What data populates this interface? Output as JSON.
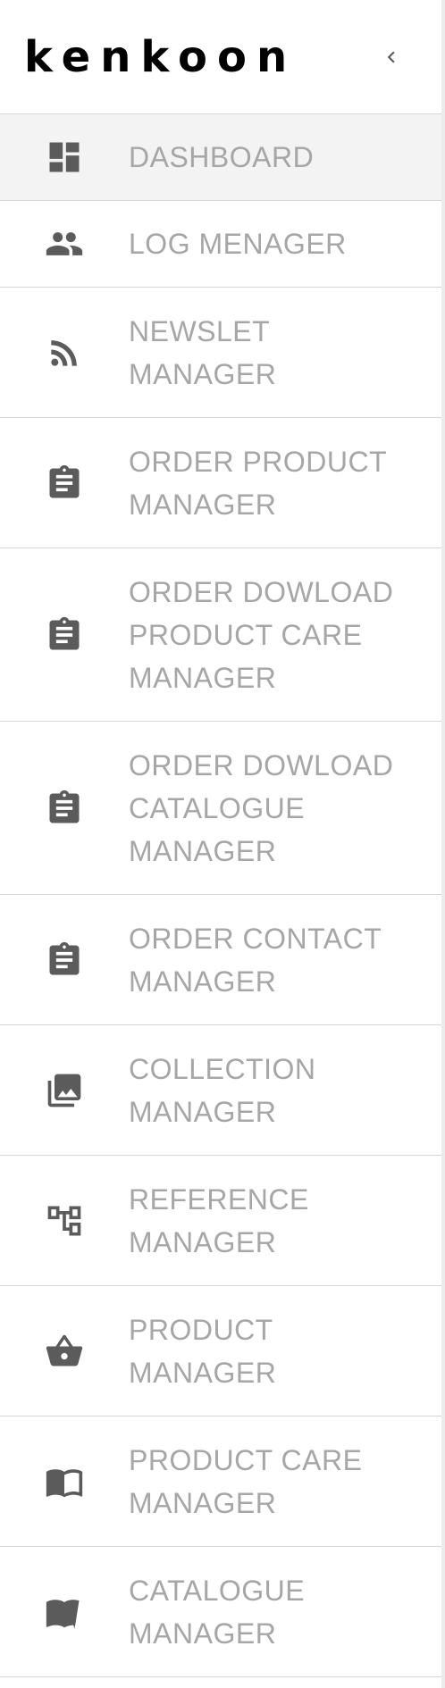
{
  "brand": {
    "logo_text": "kenkoon"
  },
  "header": {
    "collapse_icon": "chevron-left-icon"
  },
  "menu": {
    "items": [
      {
        "line1": "DASHBOARD",
        "line2": "",
        "line3": "",
        "icon": "dashboard-icon",
        "active": true
      },
      {
        "line1": "LOG MENAGER",
        "line2": "",
        "line3": "",
        "icon": "people-icon",
        "active": false
      },
      {
        "line1": "NEWSLET",
        "line2": "MANAGER",
        "line3": "",
        "icon": "rss-feed-icon",
        "active": false
      },
      {
        "line1": "ORDER PRODUCT",
        "line2": "MANAGER",
        "line3": "",
        "icon": "clipboard-icon",
        "active": false
      },
      {
        "line1": "ORDER DOWLOAD",
        "line2": "PRODUCT CARE",
        "line3": "MANAGER",
        "icon": "clipboard-icon",
        "active": false
      },
      {
        "line1": "ORDER DOWLOAD",
        "line2": "CATALOGUE",
        "line3": "MANAGER",
        "icon": "clipboard-icon",
        "active": false
      },
      {
        "line1": "ORDER CONTACT",
        "line2": "MANAGER",
        "line3": "",
        "icon": "clipboard-icon",
        "active": false
      },
      {
        "line1": "COLLECTION",
        "line2": "MANAGER",
        "line3": "",
        "icon": "photo-library-icon",
        "active": false
      },
      {
        "line1": "REFERENCE",
        "line2": "MANAGER",
        "line3": "",
        "icon": "account-tree-icon",
        "active": false
      },
      {
        "line1": "PRODUCT",
        "line2": "MANAGER",
        "line3": "",
        "icon": "shopping-basket-icon",
        "active": false
      },
      {
        "line1": "PRODUCT CARE",
        "line2": "MANAGER",
        "line3": "",
        "icon": "book-icon",
        "active": false
      },
      {
        "line1": "CATALOGUE",
        "line2": "MANAGER",
        "line3": "",
        "icon": "book-icon",
        "active": false
      }
    ]
  },
  "colors": {
    "icon": "#5b5b5b",
    "label": "#a6a6a6",
    "divider": "#d6d6d6",
    "active_bg": "#f3f3f3"
  }
}
